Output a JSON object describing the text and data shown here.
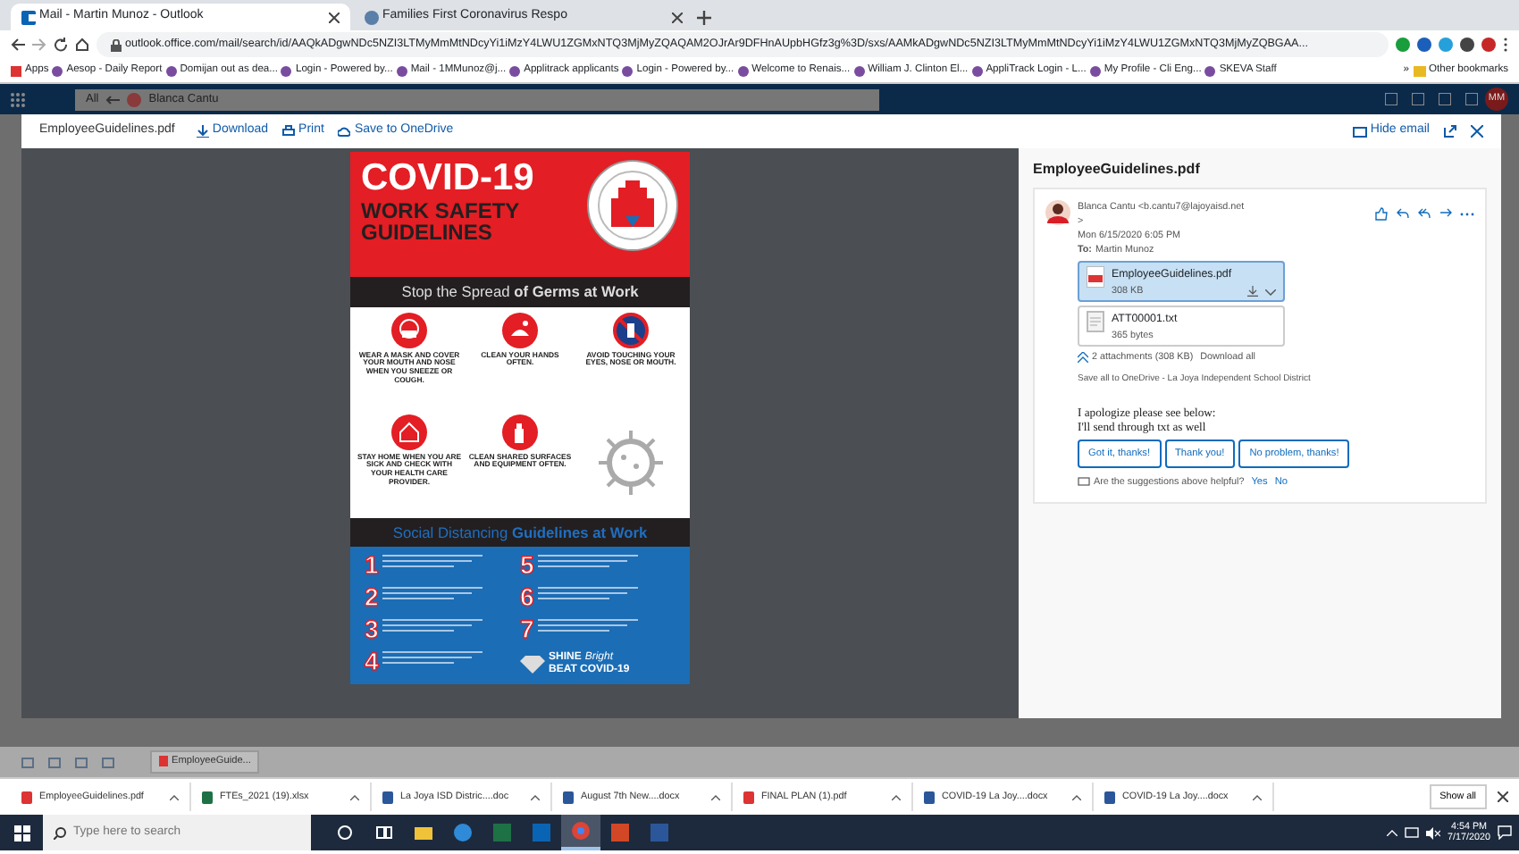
{
  "browser": {
    "tabs": [
      {
        "title": "Mail - Martin Munoz - Outlook",
        "selected": true
      },
      {
        "title": "Families First Coronavirus Respo",
        "selected": false
      }
    ],
    "address": "outlook.office.com/mail/search/id/AAQkADgwNDc5NZI3LTMyMmMtNDcyYi1iMzY4LWU1ZGMxNTQ3MjMyZQAQAM2OJrAr9DFHnAUpbHGfz3g%3D/sxs/AAMkADgwNDc5NZI3LTMyMmMtNDcyYi1iMzY4LWU1ZGMxNTQ3MjMyZQBGAA...",
    "bookmarks": [
      "Apps",
      "Aesop - Daily Report",
      "Domijan out as dea...",
      "Login - Powered by...",
      "Mail - 1MMunoz@j...",
      "Applitrack applicants",
      "Login - Powered by...",
      "Welcome to Renais...",
      "William J. Clinton El...",
      "AppliTrack Login - L...",
      "My Profile - Cli Eng...",
      "SKEVA Staff"
    ],
    "more_bookmarks": "»",
    "other_bookmarks": "Other bookmarks"
  },
  "outlook_header": {
    "scope": "All",
    "search_chip": "Blanca Cantu",
    "avatar": "MM"
  },
  "viewer": {
    "filename": "EmployeeGuidelines.pdf",
    "actions": [
      "Download",
      "Print",
      "Save to OneDrive"
    ],
    "hide_email": "Hide email"
  },
  "poster": {
    "title": "COVID-19",
    "subtitle_1": "WORK SAFETY",
    "subtitle_2": "GUIDELINES",
    "band_1": "Stop the Spread **of Germs at Work**",
    "tips": [
      {
        "kind": "mask",
        "caption": "WEAR A MASK AND COVER YOUR MOUTH AND NOSE WHEN YOU SNEEZE OR COUGH."
      },
      {
        "kind": "hands",
        "caption": "CLEAN YOUR HANDS OFTEN."
      },
      {
        "kind": "face",
        "caption": "AVOID TOUCHING YOUR EYES, NOSE OR MOUTH."
      },
      {
        "kind": "home",
        "caption": "STAY HOME WHEN YOU ARE SICK AND CHECK WITH YOUR HEALTH CARE PROVIDER."
      },
      {
        "kind": "spray",
        "caption": "CLEAN SHARED SURFACES AND EQUIPMENT OFTEN."
      }
    ],
    "band_2": "Social Distancing **Guidelines at Work**",
    "numbers": [
      "1",
      "2",
      "3",
      "4",
      "5",
      "6",
      "7"
    ],
    "logo_1": "SHINE",
    "logo_2": "Bright",
    "logo_3": "BEAT COVID-19"
  },
  "email": {
    "title": "EmployeeGuidelines.pdf",
    "sender": "Blanca Cantu <b.cantu7@lajoyaisd.net",
    "sender_end": ">",
    "date": "Mon 6/15/2020 6:05 PM",
    "to_label": "To:",
    "to": "Martin Munoz",
    "attachments": [
      {
        "name": "EmployeeGuidelines.pdf",
        "size": "308 KB",
        "kind": "pdf",
        "selected": true
      },
      {
        "name": "ATT00001.txt",
        "size": "365 bytes",
        "kind": "txt",
        "selected": false
      }
    ],
    "attachment_count": "2 attachments (308 KB)",
    "download_all": "Download all",
    "save_all": "Save all to OneDrive - La Joya Independent School District",
    "body": [
      "I apologize please see below:",
      "I'll send through txt as well"
    ],
    "quick_replies": [
      "Got it, thanks!",
      "Thank you!",
      "No problem, thanks!"
    ],
    "feedback": "Are the suggestions above helpful?",
    "yes": "Yes",
    "no": "No"
  },
  "app_footer": {
    "chip": "EmployeeGuide..."
  },
  "downloads": {
    "items": [
      {
        "name": "EmployeeGuidelines.pdf",
        "kind": "pdf"
      },
      {
        "name": "FTEs_2021 (19).xlsx",
        "kind": "xlsx"
      },
      {
        "name": "La Joya ISD Distric....doc",
        "kind": "doc"
      },
      {
        "name": "August 7th New....docx",
        "kind": "doc"
      },
      {
        "name": "FINAL PLAN (1).pdf",
        "kind": "pdf"
      },
      {
        "name": "COVID-19 La Joy....docx",
        "kind": "doc"
      },
      {
        "name": "COVID-19 La Joy....docx",
        "kind": "doc"
      }
    ],
    "show_all": "Show all"
  },
  "taskbar": {
    "search_placeholder": "Type here to search",
    "apps": [
      {
        "kind": "cortana",
        "selected": false
      },
      {
        "kind": "taskview",
        "selected": false
      },
      {
        "kind": "explorer",
        "selected": false
      },
      {
        "kind": "edge",
        "selected": false
      },
      {
        "kind": "excel",
        "selected": false
      },
      {
        "kind": "outlook",
        "selected": false
      },
      {
        "kind": "chrome",
        "selected": true
      },
      {
        "kind": "powerpoint",
        "selected": false
      },
      {
        "kind": "word",
        "selected": false
      }
    ],
    "time": "4:54 PM",
    "date": "7/17/2020"
  }
}
